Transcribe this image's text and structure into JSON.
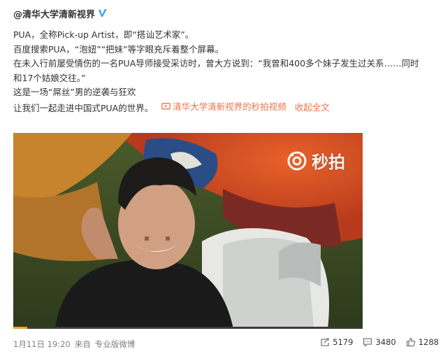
{
  "post": {
    "author": "@清华大学清新视界",
    "verified_icon": "verified-v-icon",
    "lines": [
      "PUA，全称Pick-up Artist，即“搭讪艺术家”。",
      "百度搜索PUA，“泡妞”“把妹”等字眼充斥着整个屏幕。",
      "在未入行前屡受情伤的一名PUA导师接受采访时，曾大方说到：“我曾和400多个妹子发生过关系……同时",
      "和17个姑娘交往。”",
      "这是一场“屌丝”男的逆袭与狂欢",
      "让我们一起走进中国式PUA的世界。"
    ],
    "video_link_label": "清华大学清新视界的秒拍视频",
    "collapse_label": "收起全文",
    "link_color": "#eb7350"
  },
  "video": {
    "watermark_text": "秒拍",
    "watermark_icon": "miaopai-logo-icon",
    "progress": 0.04,
    "progress_color": "#f29f33"
  },
  "footer": {
    "date": "1月11日 19:20",
    "from_label": "来自",
    "source": "专业版微博"
  },
  "actions": {
    "repost_count": "5179",
    "comment_count": "3480",
    "like_count": "1288"
  }
}
